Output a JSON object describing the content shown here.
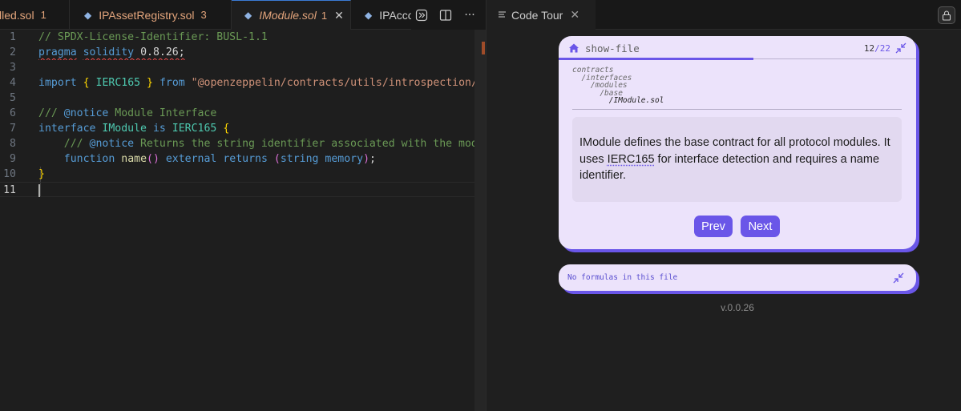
{
  "editor": {
    "tabs": [
      {
        "name": "lled.sol",
        "count": "1",
        "icon": ""
      },
      {
        "name": "IPAssetRegistry.sol",
        "count": "3",
        "icon": "ethereum-icon"
      },
      {
        "name": "IModule.sol",
        "count": "1",
        "icon": "ethereum-icon",
        "active": true
      },
      {
        "name": "IPAcco",
        "count": "",
        "icon": "ethereum-icon"
      }
    ],
    "tab_actions": [
      "open-changes-icon",
      "split-editor-icon",
      "more-actions-icon"
    ],
    "tab_action_glyphs": {
      "more": "···",
      "close": "✕"
    },
    "current_line": "11",
    "lines": [
      {
        "n": "1",
        "parts": [
          [
            "cmt",
            "// SPDX-License-Identifier: BUSL-1.1"
          ]
        ]
      },
      {
        "n": "2",
        "parts": [
          [
            "kw-sq",
            "pragma"
          ],
          [
            "pl",
            " "
          ],
          [
            "kw-sq",
            "solidity"
          ],
          [
            "pl-sq",
            " 0.8.26;"
          ]
        ]
      },
      {
        "n": "3",
        "parts": []
      },
      {
        "n": "4",
        "parts": [
          [
            "kw",
            "import"
          ],
          [
            "pl",
            " "
          ],
          [
            "br",
            "{"
          ],
          [
            "pl",
            " "
          ],
          [
            "ty",
            "IERC165"
          ],
          [
            "pl",
            " "
          ],
          [
            "br",
            "}"
          ],
          [
            "pl",
            " "
          ],
          [
            "kw",
            "from"
          ],
          [
            "pl",
            " "
          ],
          [
            "str",
            "\"@openzeppelin/contracts/utils/introspection/IERC"
          ]
        ]
      },
      {
        "n": "5",
        "parts": []
      },
      {
        "n": "6",
        "parts": [
          [
            "cmt",
            "/// "
          ],
          [
            "kw",
            "@notice"
          ],
          [
            "cmt",
            " Module Interface"
          ]
        ]
      },
      {
        "n": "7",
        "parts": [
          [
            "kw",
            "interface"
          ],
          [
            "pl",
            " "
          ],
          [
            "ty",
            "IModule"
          ],
          [
            "pl",
            " "
          ],
          [
            "kw",
            "is"
          ],
          [
            "pl",
            " "
          ],
          [
            "ty",
            "IERC165"
          ],
          [
            "pl",
            " "
          ],
          [
            "br",
            "{"
          ]
        ]
      },
      {
        "n": "8",
        "parts": [
          [
            "pl",
            "    "
          ],
          [
            "cmt",
            "/// "
          ],
          [
            "kw",
            "@notice"
          ],
          [
            "cmt",
            " Returns the string identifier associated with the module."
          ]
        ]
      },
      {
        "n": "9",
        "parts": [
          [
            "pl",
            "    "
          ],
          [
            "kw",
            "function"
          ],
          [
            "pl",
            " "
          ],
          [
            "fn",
            "name"
          ],
          [
            "br2",
            "()"
          ],
          [
            "pl",
            " "
          ],
          [
            "kw",
            "external"
          ],
          [
            "pl",
            " "
          ],
          [
            "kw",
            "returns"
          ],
          [
            "pl",
            " "
          ],
          [
            "br2",
            "("
          ],
          [
            "kw",
            "string"
          ],
          [
            "pl",
            " "
          ],
          [
            "kw",
            "memory"
          ],
          [
            "br2",
            ")"
          ],
          [
            "pl",
            ";"
          ]
        ]
      },
      {
        "n": "10",
        "parts": [
          [
            "br",
            "}"
          ]
        ]
      },
      {
        "n": "11",
        "parts": []
      }
    ]
  },
  "panel": {
    "tab_label": "Code Tour",
    "tab_close": "✕",
    "step": {
      "label": "show-file",
      "index": "12",
      "separator": "/",
      "total": "22",
      "progress": 0.545
    },
    "path": [
      "contracts",
      "  /interfaces",
      "    /modules",
      "      /base",
      "        /IModule.sol"
    ],
    "description": {
      "before": "IModule defines the base contract for all protocol modules. It uses ",
      "code_ref": "IERC165",
      "after": " for interface detection and requires a name identifier."
    },
    "buttons": {
      "prev": "Prev",
      "next": "Next"
    },
    "formula_text": "No formulas in this file",
    "version": "v.0.0.26"
  },
  "colors": {
    "accent": "#6a56e8",
    "card_bg": "#ece3fb",
    "editor_bg": "#1e1e1e"
  }
}
